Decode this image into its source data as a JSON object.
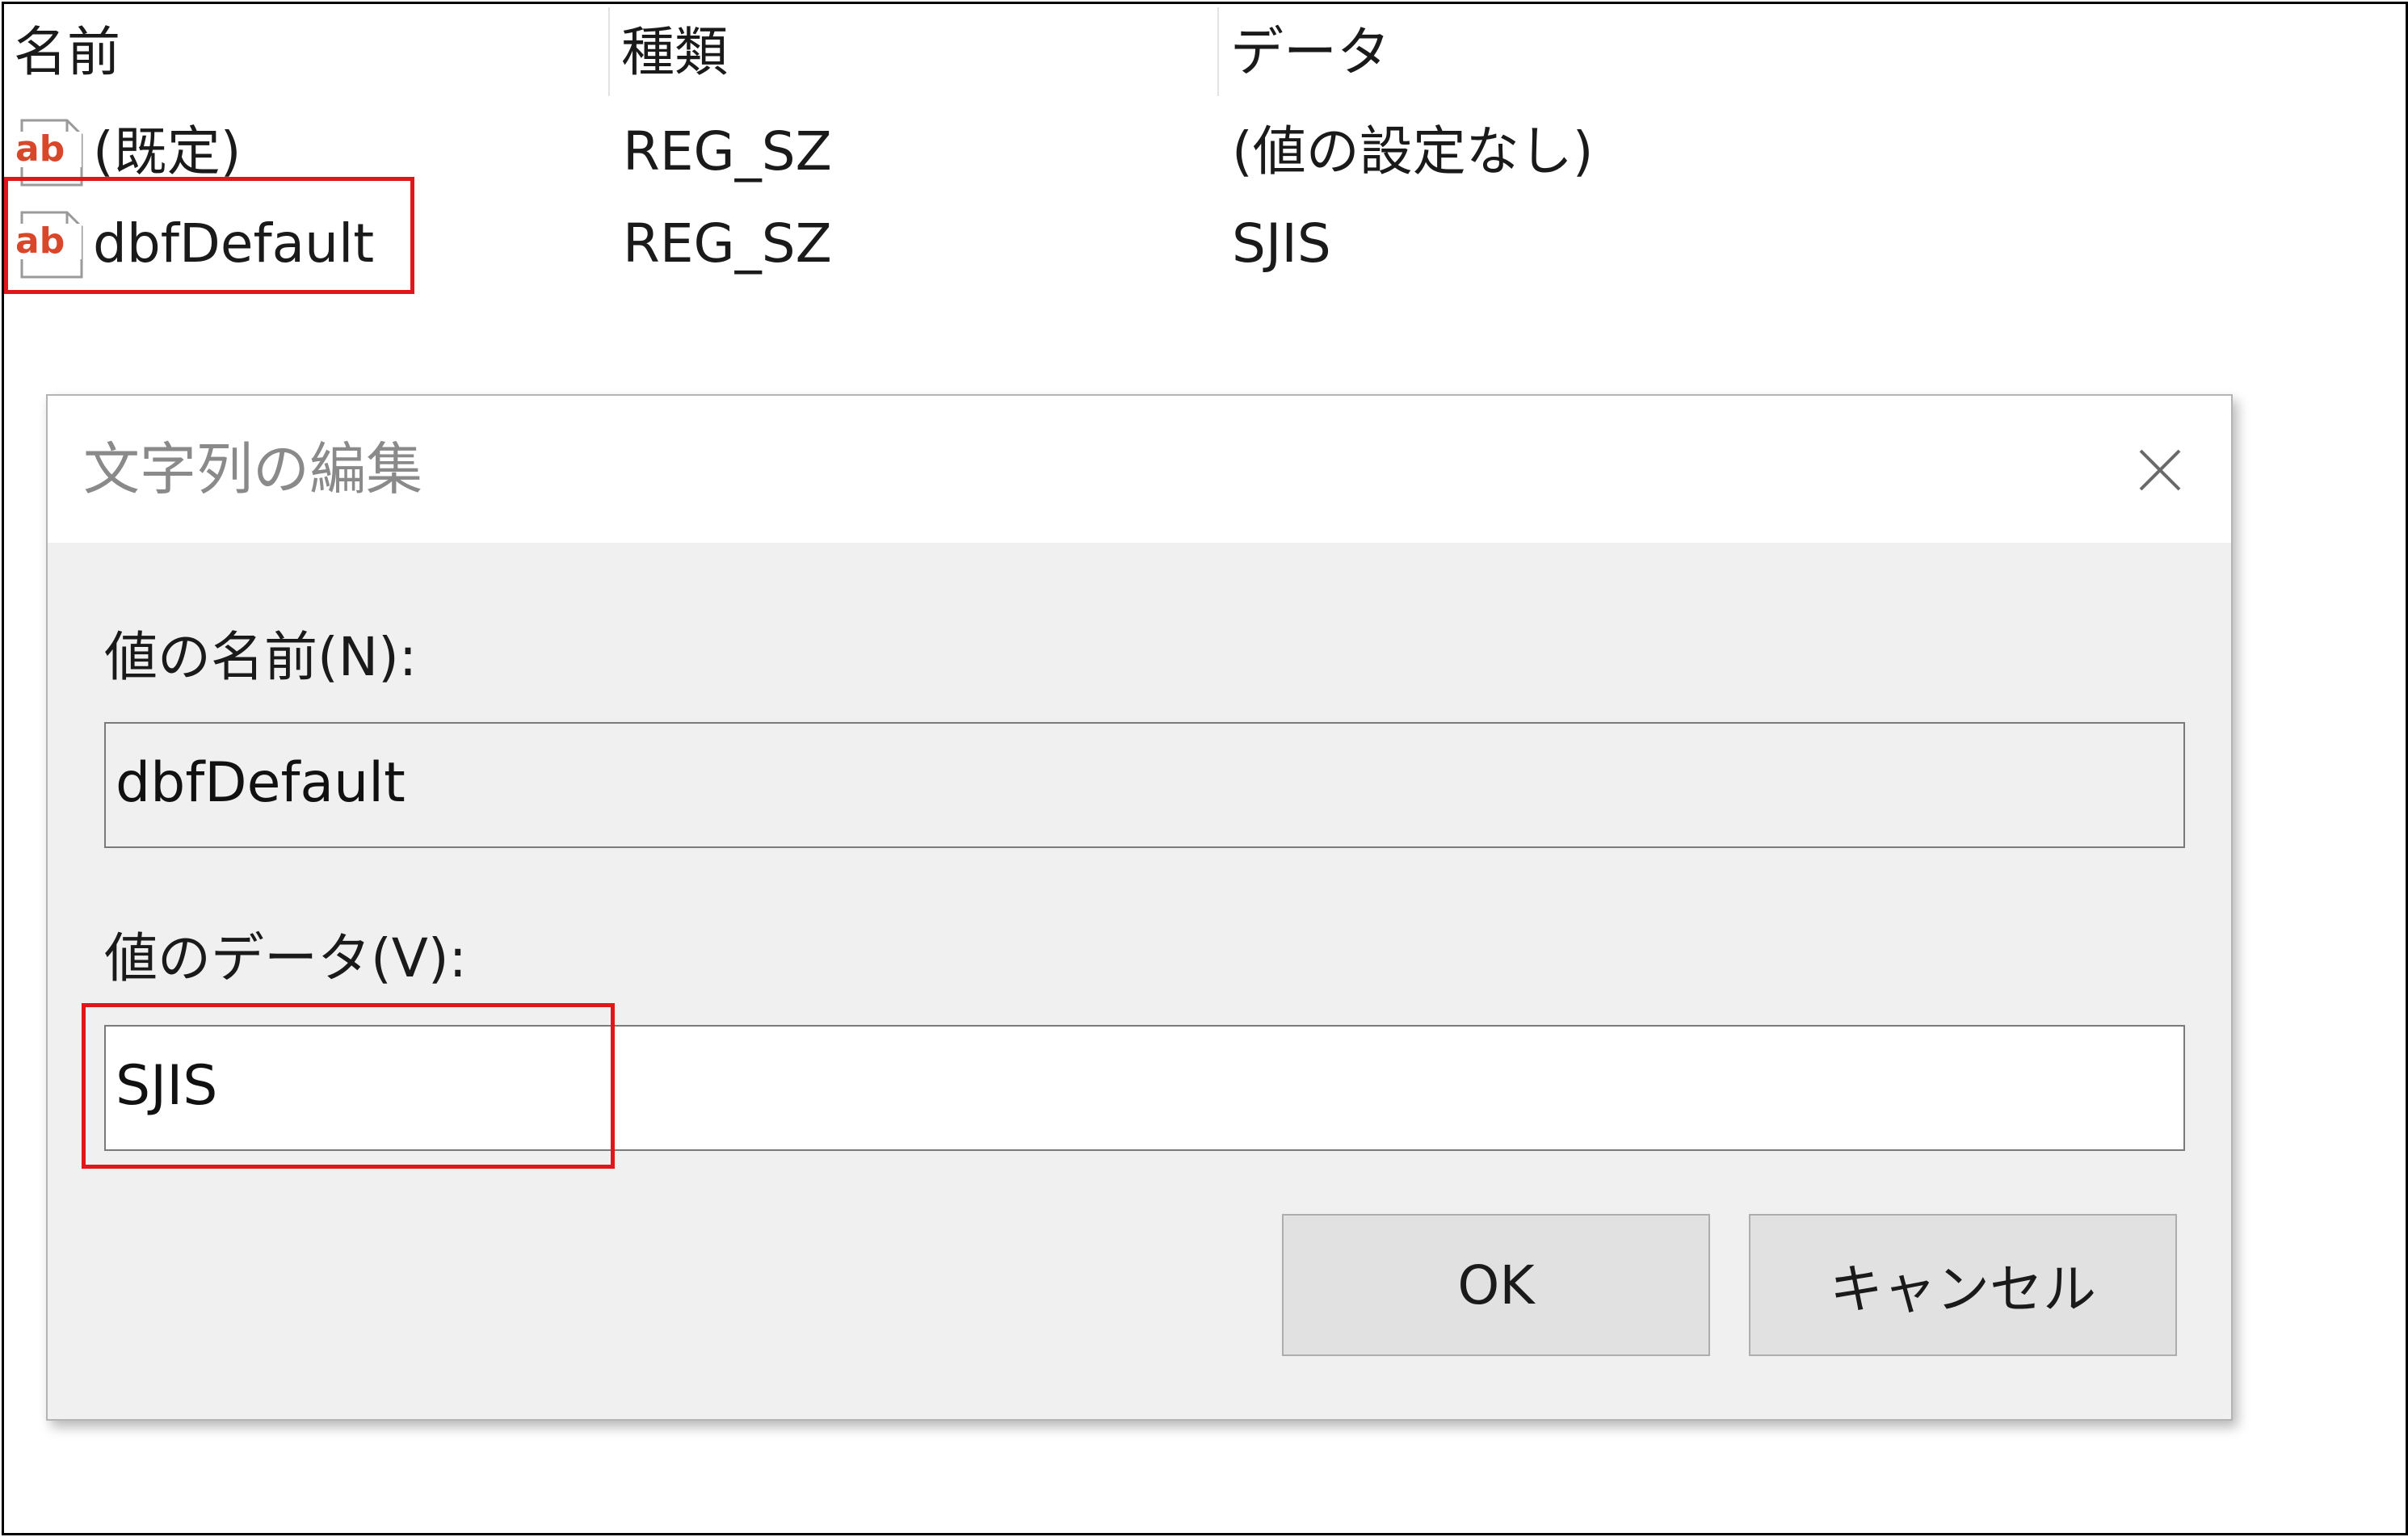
{
  "list": {
    "columns": [
      "名前",
      "種類",
      "データ"
    ],
    "rows": [
      {
        "name": "(既定)",
        "type": "REG_SZ",
        "data": "(値の設定なし)",
        "icon": "reg-string-icon"
      },
      {
        "name": "dbfDefault",
        "type": "REG_SZ",
        "data": "SJIS",
        "icon": "reg-string-icon"
      }
    ],
    "icon_text": "ab"
  },
  "dialog": {
    "title": "文字列の編集",
    "name_label": "値の名前(N):",
    "name_value": "dbfDefault",
    "data_label": "値のデータ(V):",
    "data_value": "SJIS",
    "ok_label": "OK",
    "cancel_label": "キャンセル"
  },
  "colors": {
    "highlight": "#e0161b",
    "icon_accent": "#d9472b",
    "dialog_bg": "#f0f0f0"
  }
}
